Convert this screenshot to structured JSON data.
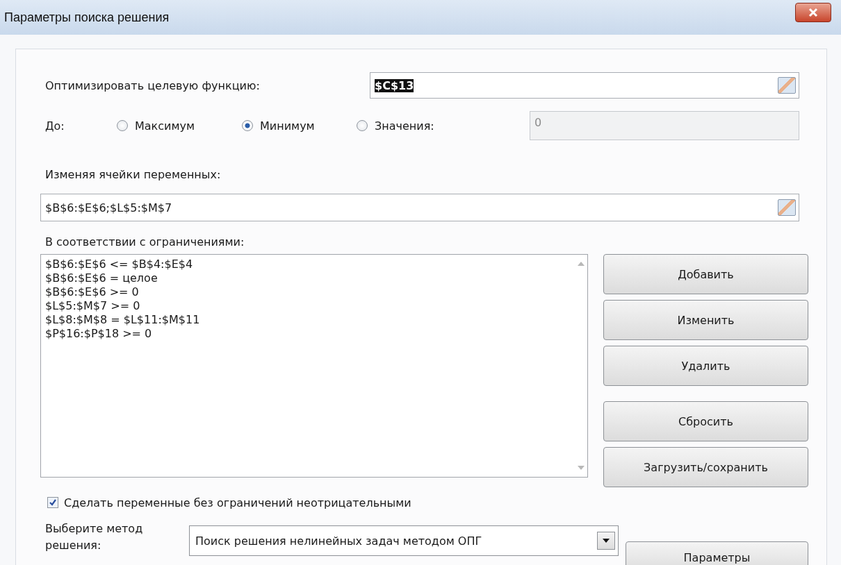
{
  "window": {
    "title": "Параметры поиска решения"
  },
  "objective": {
    "label": "Оптимизировать целевую функцию:",
    "value": "$C$13",
    "selected": true
  },
  "to": {
    "label": "До:",
    "options": [
      {
        "label": "Максимум",
        "selected": false
      },
      {
        "label": "Минимум",
        "selected": true
      },
      {
        "label": "Значения:",
        "selected": false
      }
    ],
    "value_field": {
      "value": "0",
      "disabled": true
    }
  },
  "variables": {
    "label": "Изменяя ячейки переменных:",
    "value": "$B$6:$E$6;$L$5:$M$7"
  },
  "constraints": {
    "label": "В соответствии с ограничениями:",
    "items": [
      "$B$6:$E$6 <= $B$4:$E$4",
      "$B$6:$E$6 = целое",
      "$B$6:$E$6 >= 0",
      "$L$5:$M$7 >= 0",
      "$L$8:$M$8 = $L$11:$M$11",
      "$P$16:$P$18 >= 0"
    ]
  },
  "constraint_buttons": [
    "Добавить",
    "Изменить",
    "Удалить"
  ],
  "file_buttons": [
    "Сбросить",
    "Загрузить/сохранить"
  ],
  "nonnegative": {
    "label": "Сделать переменные без ограничений неотрицательными",
    "checked": true
  },
  "method": {
    "label": "Выберите метод решения:",
    "value": "Поиск решения нелинейных задач методом ОПГ"
  },
  "options_button": "Параметры"
}
